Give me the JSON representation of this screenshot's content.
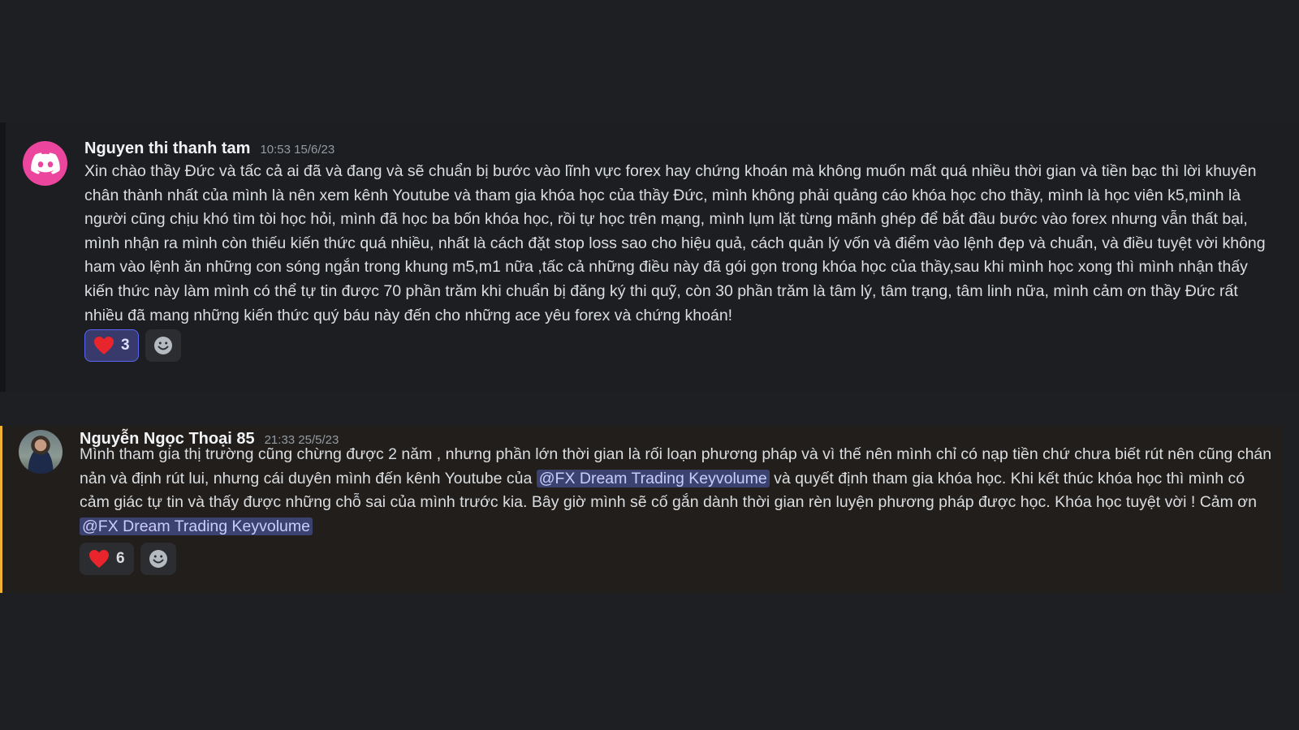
{
  "messages": [
    {
      "username": "Nguyen thi thanh tam",
      "timestamp": "10:53 15/6/23",
      "avatar_icon": "discord-logo-icon",
      "text": "Xin chào thầy Đức và tấc cả ai đã và đang và sẽ chuẩn bị bước vào lĩnh vực forex hay chứng khoán  mà không muốn mất quá nhiều thời gian và tiền bạc thì lời khuyên chân thành nhất của mình là nên xem kênh Youtube và tham gia khóa học của thầy Đức, mình không phải quảng cáo khóa học cho thầy, mình là học viên k5,mình là người cũng chịu khó tìm tòi học hỏi, mình đã học ba bốn khóa học, rồi tự học trên mạng, mình lụm lặt từng mãnh ghép để bắt đầu bước vào forex nhưng vẫn thất bại, mình nhận ra mình còn thiếu kiến thức quá nhiều, nhất là cách đặt stop loss sao cho hiệu quả, cách quản lý vốn và điểm vào lệnh đẹp và chuẩn, và điều tuyệt vời không ham vào lệnh ăn những con sóng ngắn trong khung m5,m1 nữa ,tấc cả những điều này đã gói gọn trong khóa học của thầy,sau khi mình học xong thì mình nhận thấy kiến thức này làm mình có thể tự tin được 70 phần trăm khi chuẩn bị đăng ký thi quỹ, còn 30 phần trăm là tâm lý, tâm trạng, tâm linh nữa, mình cảm ơn thầy Đức rất nhiều đã mang những kiến thức quý báu này đến cho những ace yêu forex và chứng khoán!",
      "reaction": {
        "emoji": "heart-icon",
        "count": "3"
      }
    },
    {
      "username": "Nguyễn Ngọc Thoại 85",
      "timestamp": "21:33 25/5/23",
      "avatar_icon": "user-photo-avatar",
      "text_part1": "Mình tham gia thị trường cũng chừng được 2 năm , nhưng phần lớn thời gian là rối loạn phương pháp và vì thế  nên mình chỉ có nạp tiền chứ chưa biết rút nên cũng chán nản và định rút lui, nhưng cái duyên mình đến kênh Youtube của ",
      "mention1": "@FX Dream Trading Keyvolume",
      "text_part2": " và quyết định tham gia khóa học. Khi kết thúc khóa học thì mình có cảm giác tự tin và thấy  được những chỗ sai của mình trước kia. Bây giờ mình sẽ cố gắn dành thời gian rèn luyện  phương pháp được học. Khóa học tuyệt vời ! Cảm ơn ",
      "mention2": "@FX Dream Trading Keyvolume",
      "reaction": {
        "emoji": "heart-icon",
        "count": "6"
      }
    }
  ],
  "colors": {
    "background": "#1e1f22",
    "highlight_bar": "#f0b232",
    "mention_bg": "#3c4270",
    "mention_text": "#c9cdfb",
    "heart": "#e8242c",
    "discord_avatar": "#eb459e"
  }
}
